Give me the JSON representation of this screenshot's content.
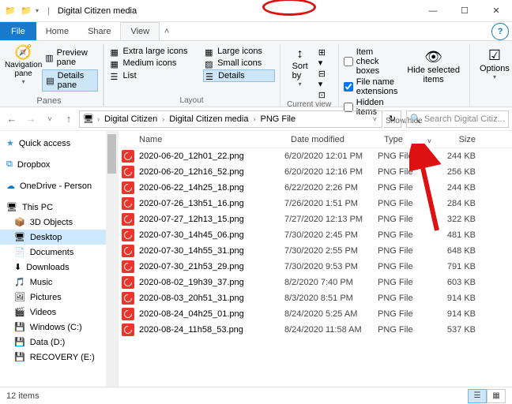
{
  "titlebar": {
    "title": "Digital Citizen media"
  },
  "tabs": {
    "file": "File",
    "home": "Home",
    "share": "Share",
    "view": "View"
  },
  "ribbon": {
    "nav_pane": "Navigation\npane",
    "preview_pane": "Preview pane",
    "details_pane": "Details pane",
    "panes_label": "Panes",
    "layout": {
      "extra_large": "Extra large icons",
      "large": "Large icons",
      "medium": "Medium icons",
      "small": "Small icons",
      "list": "List",
      "details": "Details",
      "label": "Layout"
    },
    "current_view": {
      "sort_by": "Sort\nby",
      "group_by": "Group by",
      "add_cols": "Add columns",
      "size_cols": "Size columns",
      "label": "Current view"
    },
    "show_hide": {
      "item_check": "Item check boxes",
      "file_ext": "File name extensions",
      "hidden": "Hidden items",
      "hide_sel": "Hide selected\nitems",
      "label": "Show/hide"
    },
    "options": "Options"
  },
  "breadcrumbs": {
    "p1": "Digital Citizen",
    "p2": "Digital Citizen media",
    "p3": "PNG File"
  },
  "addr": {
    "search_placeholder": "Search Digital Citiz..."
  },
  "sidebar": {
    "quick": "Quick access",
    "dropbox": "Dropbox",
    "onedrive": "OneDrive - Person",
    "thispc": "This PC",
    "obj3d": "3D Objects",
    "desktop": "Desktop",
    "documents": "Documents",
    "downloads": "Downloads",
    "music": "Music",
    "pictures": "Pictures",
    "videos": "Videos",
    "cdrive": "Windows (C:)",
    "ddrive": "Data (D:)",
    "edrive": "RECOVERY (E:)"
  },
  "columns": {
    "name": "Name",
    "date": "Date modified",
    "type": "Type",
    "size": "Size"
  },
  "files": [
    {
      "name": "2020-06-20_12h01_22.png",
      "date": "6/20/2020 12:01 PM",
      "type": "PNG File",
      "size": "244 KB"
    },
    {
      "name": "2020-06-20_12h16_52.png",
      "date": "6/20/2020 12:16 PM",
      "type": "PNG File",
      "size": "256 KB"
    },
    {
      "name": "2020-06-22_14h25_18.png",
      "date": "6/22/2020 2:26 PM",
      "type": "PNG File",
      "size": "244 KB"
    },
    {
      "name": "2020-07-26_13h51_16.png",
      "date": "7/26/2020 1:51 PM",
      "type": "PNG File",
      "size": "284 KB"
    },
    {
      "name": "2020-07-27_12h13_15.png",
      "date": "7/27/2020 12:13 PM",
      "type": "PNG File",
      "size": "322 KB"
    },
    {
      "name": "2020-07-30_14h45_06.png",
      "date": "7/30/2020 2:45 PM",
      "type": "PNG File",
      "size": "481 KB"
    },
    {
      "name": "2020-07-30_14h55_31.png",
      "date": "7/30/2020 2:55 PM",
      "type": "PNG File",
      "size": "648 KB"
    },
    {
      "name": "2020-07-30_21h53_29.png",
      "date": "7/30/2020 9:53 PM",
      "type": "PNG File",
      "size": "791 KB"
    },
    {
      "name": "2020-08-02_19h39_37.png",
      "date": "8/2/2020 7:40 PM",
      "type": "PNG File",
      "size": "603 KB"
    },
    {
      "name": "2020-08-03_20h51_31.png",
      "date": "8/3/2020 8:51 PM",
      "type": "PNG File",
      "size": "914 KB"
    },
    {
      "name": "2020-08-24_04h25_01.png",
      "date": "8/24/2020 5:25 AM",
      "type": "PNG File",
      "size": "914 KB"
    },
    {
      "name": "2020-08-24_11h58_53.png",
      "date": "8/24/2020 11:58 AM",
      "type": "PNG File",
      "size": "537 KB"
    }
  ],
  "status": {
    "count": "12 items"
  }
}
